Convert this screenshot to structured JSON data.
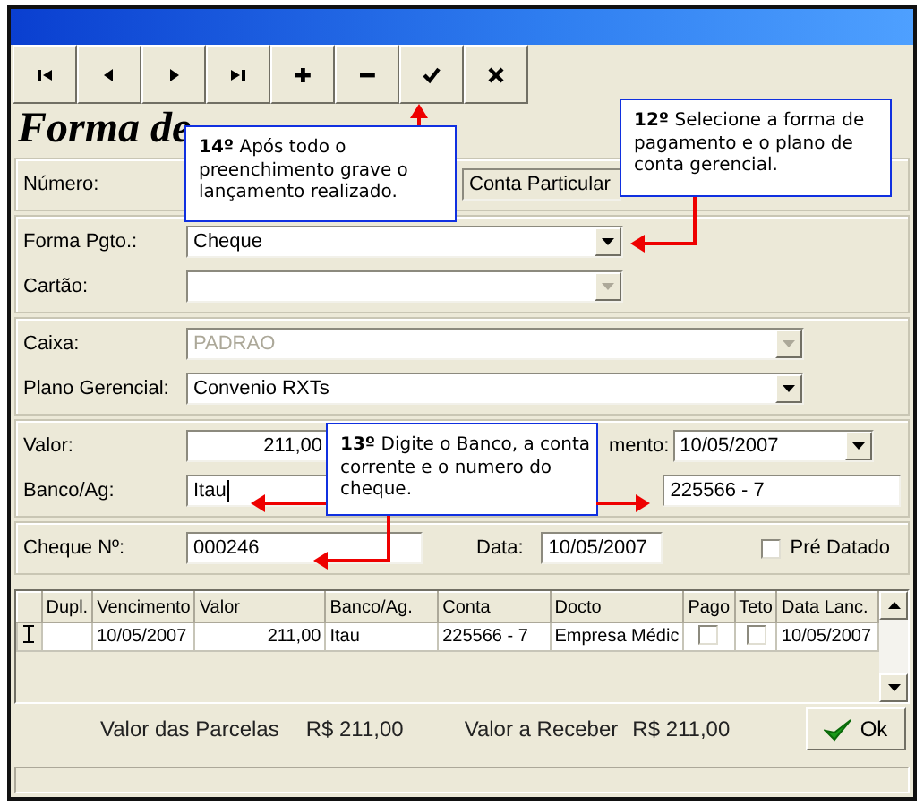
{
  "toolbar": [
    {
      "kind": "first"
    },
    {
      "kind": "prev"
    },
    {
      "kind": "next"
    },
    {
      "kind": "last"
    },
    {
      "kind": "add"
    },
    {
      "kind": "remove"
    },
    {
      "kind": "confirm"
    },
    {
      "kind": "cancel"
    }
  ],
  "heading": "Forma de",
  "numero": {
    "label": "Número:",
    "conta": "Conta Particular"
  },
  "pagamento": [
    {
      "label": "Forma Pgto.:",
      "value": "Cheque",
      "disabled": false
    },
    {
      "label": "Cartão:",
      "disabled": true
    }
  ],
  "caixa": [
    {
      "label": "Caixa:",
      "value": "PADRAO",
      "disabled": true
    },
    {
      "label": "Plano Gerencial:",
      "value": "Convenio RXTs",
      "disabled": false
    }
  ],
  "valor": {
    "label": "Valor:",
    "value": "211,00",
    "venc_label": "mento:",
    "venc_value": "10/05/2007"
  },
  "banco": {
    "label": "Banco/Ag:",
    "value": "Itau",
    "conta": "225566 - 7"
  },
  "cheque": {
    "label": "Cheque Nº:",
    "value": "000246",
    "data_label": "Data:",
    "data_value": "10/05/2007",
    "pre_label": "Pré Datado",
    "pre_checked": false
  },
  "grid": {
    "columns": [
      "Dupl.",
      "Vencimento",
      "Valor",
      "Banco/Ag.",
      "Conta",
      "Docto",
      "Pago",
      "Teto",
      "Data Lanc."
    ],
    "rows": [
      {
        "vencimento": "10/05/2007",
        "valor": "211,00",
        "banco": "Itau",
        "conta": "225566 - 7",
        "docto": "Empresa Médic",
        "pago": false,
        "teto": false,
        "data": "10/05/2007"
      }
    ]
  },
  "footer": {
    "parcelas_label": "Valor das Parcelas",
    "parcelas": "R$ 211,00",
    "receber_label": "Valor a Receber",
    "receber": "R$ 211,00",
    "ok": "Ok"
  },
  "callouts": [
    {
      "text": "**14º** Após todo o preenchimento grave o lançamento realizado."
    },
    {
      "text": "**12º** Selecione a forma de pagamento e o plano de conta gerencial."
    },
    {
      "text": "**13º** Digite o Banco, a conta corrente e o numero do cheque."
    }
  ]
}
